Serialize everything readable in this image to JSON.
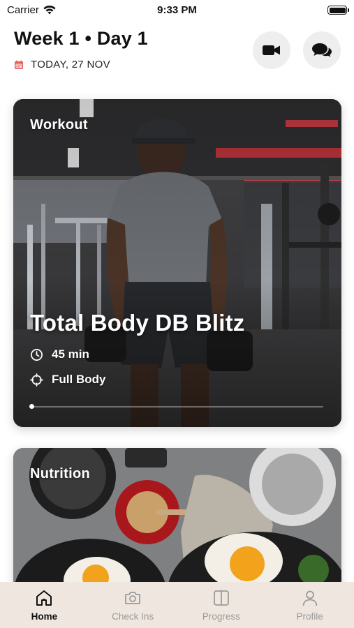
{
  "status_bar": {
    "carrier": "Carrier",
    "time": "9:33 PM"
  },
  "header": {
    "title": "Week 1 • Day 1",
    "date": "TODAY, 27 NOV"
  },
  "workout_card": {
    "label": "Workout",
    "name": "Total Body DB Blitz",
    "duration": "45 min",
    "body_part": "Full Body",
    "progress": 0
  },
  "nutrition_card": {
    "label": "Nutrition"
  },
  "tabbar": {
    "tabs": [
      {
        "label": "Home",
        "icon": "home-icon",
        "active": true
      },
      {
        "label": "Check Ins",
        "icon": "camera-icon",
        "active": false
      },
      {
        "label": "Progress",
        "icon": "split-panel-icon",
        "active": false
      },
      {
        "label": "Profile",
        "icon": "person-icon",
        "active": false
      }
    ]
  },
  "colors": {
    "accent": "#111111",
    "tabbar_bg": "#efe7df",
    "date_icon": "#e0605a",
    "inactive_tab": "#9a9a9a"
  }
}
